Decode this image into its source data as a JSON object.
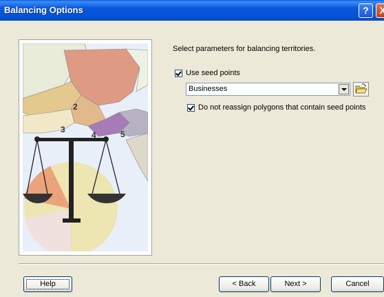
{
  "window": {
    "title": "Balancing Options",
    "help_glyph": "?",
    "close_glyph": "X"
  },
  "illustration": {
    "map_labels": [
      "2",
      "3",
      "4",
      "5"
    ]
  },
  "content": {
    "prompt": "Select parameters for balancing territories.",
    "use_seed_points": {
      "label": "Use seed points",
      "checked": true
    },
    "seed_layer": {
      "value": "Businesses"
    },
    "no_reassign": {
      "label": "Do not reassign polygons that contain seed points",
      "checked": true
    }
  },
  "buttons": {
    "help": "Help",
    "back": "< Back",
    "next": "Next >",
    "cancel": "Cancel"
  }
}
